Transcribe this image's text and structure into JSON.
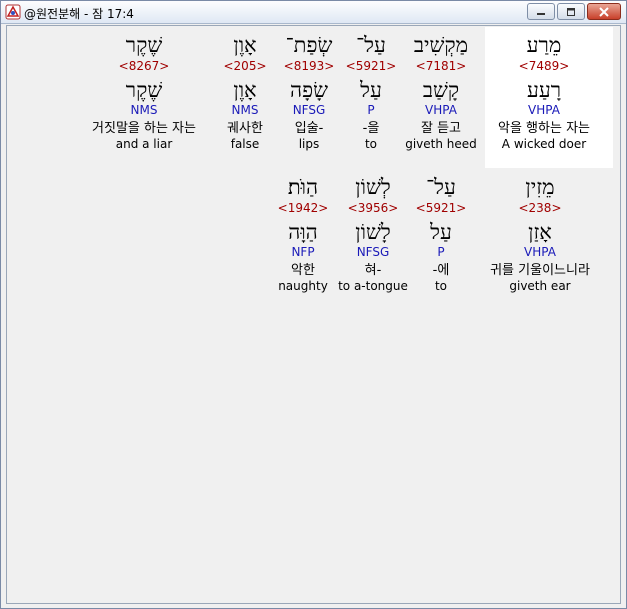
{
  "window": {
    "title": "@원전분해 - 잠 17:4"
  },
  "rows": [
    {
      "words": [
        {
          "hebrew": "מֵרַע",
          "strong": "<7489>",
          "lemma": "רָעַע",
          "morph": "VHPA",
          "korean": "악을 행하는 자는",
          "english": "A wicked doer",
          "selected": true
        },
        {
          "hebrew": "מַקְשִׁיב",
          "strong": "<7181>",
          "lemma": "קָשַׁב",
          "morph": "VHPA",
          "korean": "잘 듣고",
          "english": "giveth heed"
        },
        {
          "hebrew": "עַל־",
          "strong": "<5921>",
          "lemma": "עַל",
          "morph": "P",
          "korean": "-을",
          "english": "to"
        },
        {
          "hebrew": "שְׂפַת־",
          "strong": "<8193>",
          "lemma": "שָׂפָה",
          "morph": "NFSG",
          "korean": "입술-",
          "english": "lips"
        },
        {
          "hebrew": "אָוֶן",
          "strong": "<205>",
          "lemma": "אָוֶן",
          "morph": "NMS",
          "korean": "궤사한",
          "english": "false"
        },
        {
          "hebrew": "שֶׁקֶר",
          "strong": "<8267>",
          "lemma": "שֶׁקֶר",
          "morph": "NMS",
          "korean": "거짓말을 하는 자는",
          "english": "and a liar"
        }
      ]
    },
    {
      "words": [
        {
          "hebrew": "מֵזִין",
          "strong": "<238>",
          "lemma": "אָזַן",
          "morph": "VHPA",
          "korean": "귀를 기울이느니라",
          "english": "giveth ear"
        },
        {
          "hebrew": "עַל־",
          "strong": "<5921>",
          "lemma": "עַל",
          "morph": "P",
          "korean": "-에",
          "english": "to"
        },
        {
          "hebrew": "לְשׁוֹן",
          "strong": "<3956>",
          "lemma": "לָשׁוֹן",
          "morph": "NFSG",
          "korean": "혀-",
          "english": "to a-tongue"
        },
        {
          "hebrew": "הַוֺּת׃",
          "strong": "<1942>",
          "lemma": "הַוָּה",
          "morph": "NFP",
          "korean": "악한",
          "english": "naughty"
        }
      ]
    }
  ]
}
